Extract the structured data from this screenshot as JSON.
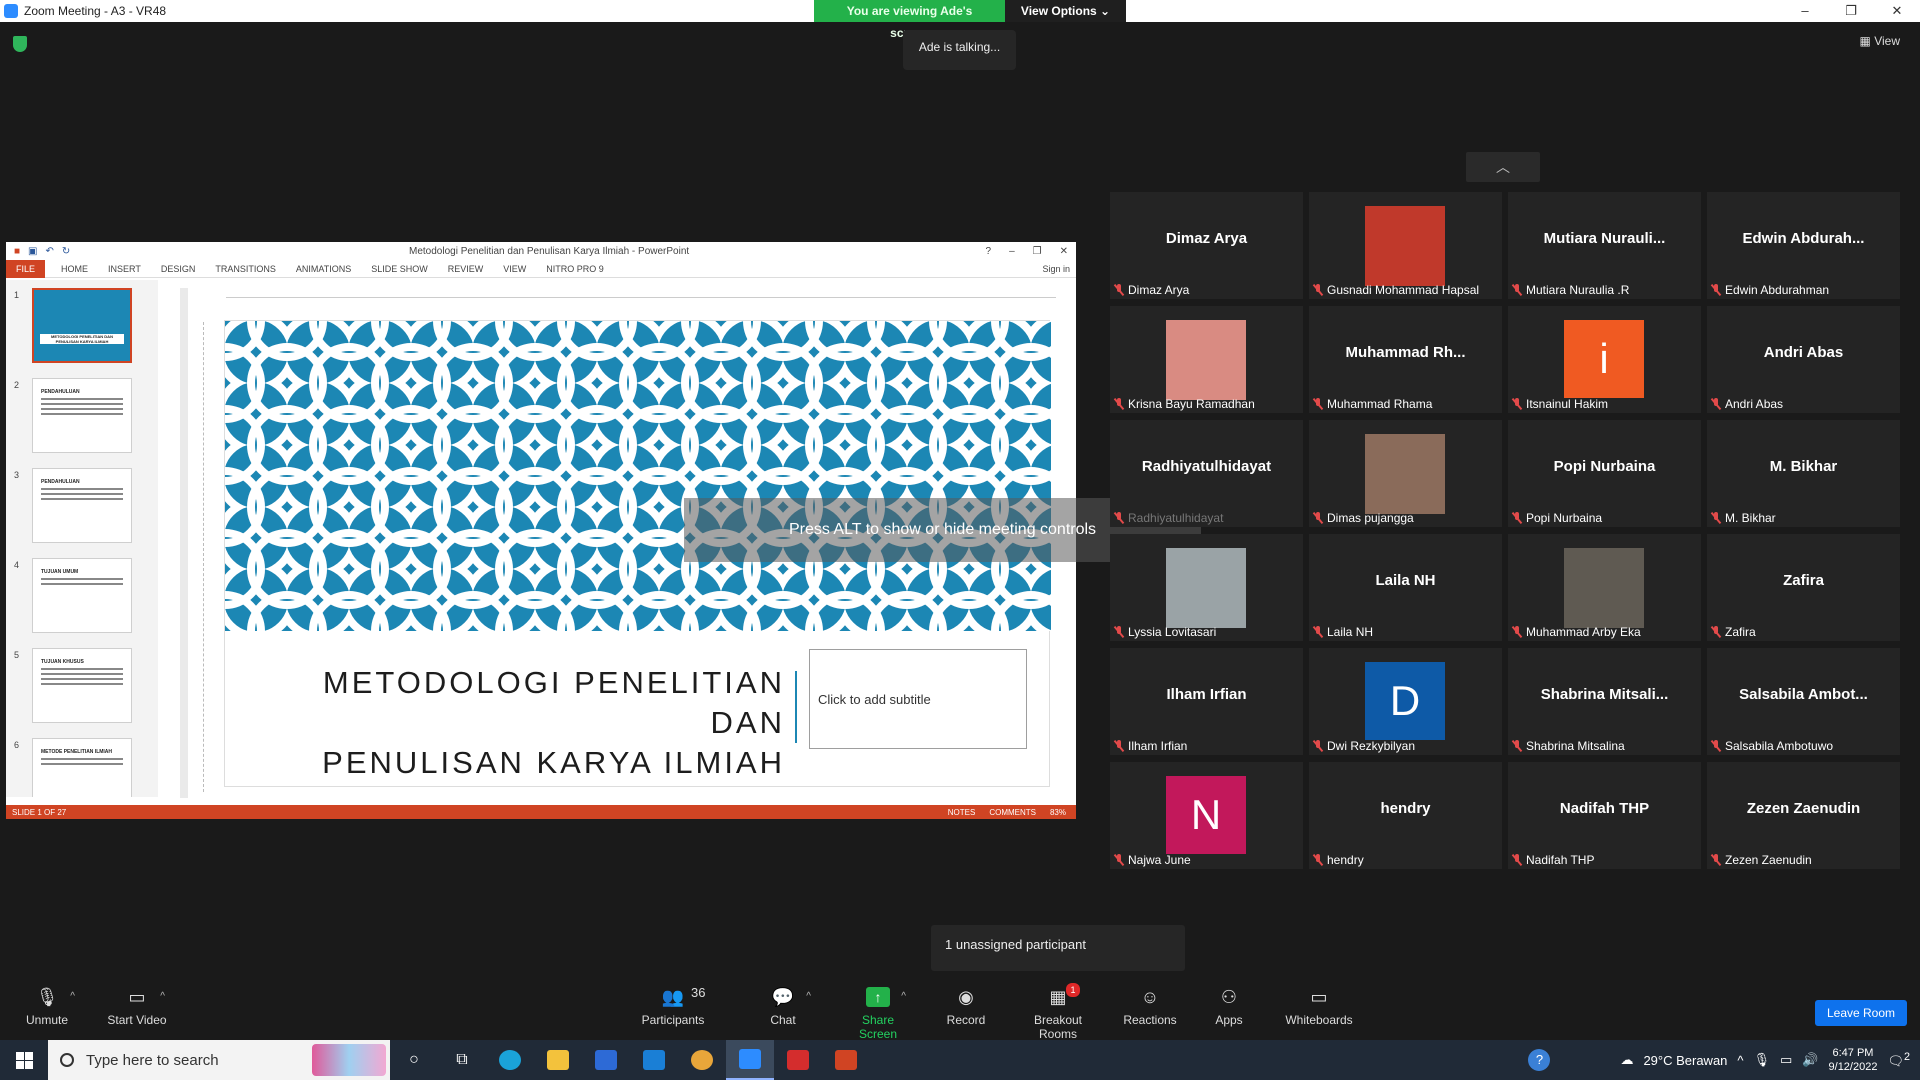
{
  "window": {
    "title": "Zoom Meeting - A3 - VR48",
    "viewing_banner": "You are viewing Ade's screen",
    "view_options": "View Options",
    "talking": "Ade is talking...",
    "view_label": "View",
    "minimize": "–",
    "maximize": "❐",
    "close": "✕"
  },
  "ppt": {
    "title": "Metodologi Penelitian dan Penulisan Karya Ilmiah - PowerPoint",
    "tabs": [
      "FILE",
      "HOME",
      "INSERT",
      "DESIGN",
      "TRANSITIONS",
      "ANIMATIONS",
      "SLIDE SHOW",
      "REVIEW",
      "VIEW",
      "NITRO PRO 9"
    ],
    "sign_in": "Sign in",
    "thumbs": [
      {
        "num": "1",
        "heading": "METODOLOGI PENELITIAN DAN PENULISAN KARYA ILMIAH"
      },
      {
        "num": "2",
        "heading": "PENDAHULUAN"
      },
      {
        "num": "3",
        "heading": "PENDAHULUAN"
      },
      {
        "num": "4",
        "heading": "TUJUAN UMUM"
      },
      {
        "num": "5",
        "heading": "TUJUAN KHUSUS"
      },
      {
        "num": "6",
        "heading": "METODE PENELITIAN ILMIAH"
      }
    ],
    "slide_title_line1": "METODOLOGI PENELITIAN DAN",
    "slide_title_line2": "PENULISAN KARYA ILMIAH",
    "subtitle_placeholder": "Click to add subtitle",
    "status_slide": "SLIDE 1 OF 27",
    "status_notes": "NOTES",
    "status_comments": "COMMENTS",
    "zoom_level": "83%"
  },
  "overlay": {
    "alt_hint": "Press ALT to show or hide meeting controls"
  },
  "participants": [
    {
      "name": "Dimaz Arya",
      "display": "Dimaz Arya",
      "type": "name"
    },
    {
      "name": "Gusnadi Mohammad Hapsal",
      "type": "photo",
      "color": "#c0392b"
    },
    {
      "name": "Mutiara Nuraulia .R",
      "display": "Mutiara  Nurauli...",
      "type": "name"
    },
    {
      "name": "Edwin Abdurahman",
      "display": "Edwin  Abdurah...",
      "type": "name"
    },
    {
      "name": "Krisna Bayu Ramadhan",
      "type": "photo",
      "color": "#d98b82"
    },
    {
      "name": "Muhammad Rhama",
      "display": "Muhammad  Rh...",
      "type": "name"
    },
    {
      "name": "Itsnainul Hakim",
      "type": "letter",
      "letter": "i",
      "color": "#f05a22"
    },
    {
      "name": "Andri Abas",
      "display": "Andri Abas",
      "type": "name"
    },
    {
      "name": "Radhiyatulhidayat",
      "display": "Radhiyatulhidayat",
      "type": "name",
      "faded": true
    },
    {
      "name": "Dimas pujangga",
      "type": "photo",
      "color": "#8a6b5a"
    },
    {
      "name": "Popi Nurbaina",
      "display": "Popi Nurbaina",
      "type": "name"
    },
    {
      "name": "M. Bikhar",
      "display": "M. Bikhar",
      "type": "name"
    },
    {
      "name": "Lyssia Lovitasari",
      "type": "photo",
      "color": "#9aa3a6"
    },
    {
      "name": "Laila NH",
      "display": "Laila NH",
      "type": "name"
    },
    {
      "name": "Muhammad Arby Eka",
      "type": "photo",
      "color": "#5f5a52"
    },
    {
      "name": "Zafira",
      "display": "Zafira",
      "type": "name"
    },
    {
      "name": "Ilham Irfian",
      "display": "Ilham Irfian",
      "type": "name"
    },
    {
      "name": "Dwi Rezkybilyan",
      "type": "letter",
      "letter": "D",
      "color": "#0e5aa7"
    },
    {
      "name": "Shabrina Mitsalina",
      "display": "Shabrina  Mitsali...",
      "type": "name"
    },
    {
      "name": "Salsabila Ambotuwo",
      "display": "Salsabila  Ambot...",
      "type": "name"
    },
    {
      "name": "Najwa June",
      "type": "letter",
      "letter": "N",
      "color": "#c2185b"
    },
    {
      "name": "hendry",
      "display": "hendry",
      "type": "name"
    },
    {
      "name": "Nadifah THP",
      "display": "Nadifah THP",
      "type": "name"
    },
    {
      "name": "Zezen Zaenudin",
      "display": "Zezen Zaenudin",
      "type": "name"
    }
  ],
  "toast": "1 unassigned participant",
  "toolbar": {
    "unmute": "Unmute",
    "start_video": "Start Video",
    "participants": "Participants",
    "participants_count": "36",
    "chat": "Chat",
    "share_screen": "Share Screen",
    "record": "Record",
    "breakout_rooms": "Breakout Rooms",
    "breakout_badge": "1",
    "reactions": "Reactions",
    "apps": "Apps",
    "whiteboards": "Whiteboards",
    "leave": "Leave Room"
  },
  "taskbar": {
    "search_placeholder": "Type here to search",
    "weather": "29°C  Berawan",
    "time": "6:47 PM",
    "date": "9/12/2022",
    "notif_count": "2"
  },
  "colors": {
    "zoom_green": "#23b14a",
    "zoom_blue": "#0e72ed",
    "ppt_orange": "#d04423",
    "slide_blue": "#1c87b4",
    "mute_red": "#e24a4a"
  }
}
